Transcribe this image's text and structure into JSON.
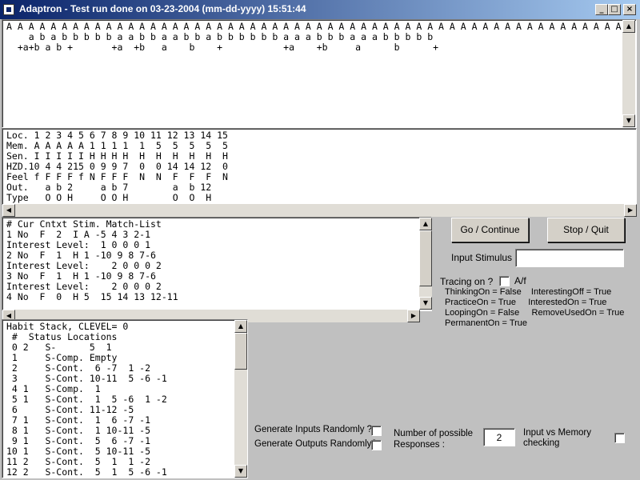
{
  "window": {
    "title": "Adaptron - Test run done on 03-23-2004 (mm-dd-yyyy) 15:51:44",
    "minimize": "_",
    "maximize": "□",
    "close": "×"
  },
  "sequence_panel": {
    "lines": [
      "A A A A A A A A A A A A A A A A A A A A A A A A A A A A A A A A A A A A A A A A A A A A A A A A A A A A A A A A A A A A A A",
      "    a b a b b b b b a a b b a a b b a b b b b b b a a a b b b a a a b b b b b",
      "  +a+b a b +       +a  +b   a    b    +           +a    +b     a      b      +"
    ]
  },
  "location_panel": {
    "lines": [
      "Loc. 1 2 3 4 5 6 7 8 9 10 11 12 13 14 15",
      "Mem. A A A A A 1 1 1 1  1  5  5  5  5  5",
      "Sen. I I I I I H H H H  H  H  H  H  H  H",
      "HZD.10 4 4 215 0 9 9 7  0  0 14 14 12  0",
      "Feel f F F F f N F F F  N  N  F  F  F  N",
      "Out.   a b 2     a b 7        a  b 12",
      "Type   O O H     O O H        O  O  H"
    ]
  },
  "match_panel": {
    "lines": [
      "# Cur Cntxt Stim. Match-List",
      "1 No  F  2  I A -5 4 3 2-1",
      "Interest Level:  1 0 0 0 1",
      "2 No  F  1  H 1 -10 9 8 7-6",
      "Interest Level:    2 0 0 0 2",
      "3 No  F  1  H 1 -10 9 8 7-6",
      "Interest Level:    2 0 0 0 2",
      "4 No  F  0  H 5  15 14 13 12-11"
    ]
  },
  "habit_panel": {
    "lines": [
      "Habit Stack, CLEVEL= 0",
      " #  Status Locations",
      " 0 2   S-      5  1",
      " 1     S-Comp. Empty",
      " 2     S-Cont.  6 -7  1 -2",
      " 3     S-Cont. 10-11  5 -6 -1",
      " 4 1   S-Comp.  1",
      " 5 1   S-Cont.  1  5 -6  1 -2",
      " 6     S-Cont. 11-12 -5",
      " 7 1   S-Cont.  1  6 -7 -1",
      " 8 1   S-Cont.  1 10-11 -5",
      " 9 1   S-Cont.  5  6 -7 -1",
      "10 1   S-Cont.  5 10-11 -5",
      "11 2   S-Cont.  5  1  1 -2",
      "12 2   S-Cont.  5  1  5 -6 -1"
    ]
  },
  "controls": {
    "go_label": "Go / Continue",
    "stop_label": "Stop / Quit",
    "input_stimulus_label": "Input Stimulus :",
    "input_stimulus_value": "",
    "tracing_label": "Tracing on ?",
    "af_label": "A/f",
    "status_lines": [
      "ThinkingOn = False    InterestingOff = True",
      "PracticeOn = True     InterestedOn = True",
      "LoopingOn = False     RemoveUsedOn = True",
      "PermanentOn = True"
    ],
    "gen_inputs_label": "Generate Inputs Randomly ?",
    "gen_outputs_label": "Generate Outputs Randomly?",
    "num_responses_label_1": "Number of possible",
    "num_responses_label_2": "Responses :",
    "num_responses_value": "2",
    "input_vs_memory_1": "Input vs Memory",
    "input_vs_memory_2": "checking"
  },
  "scroll": {
    "up": "▲",
    "down": "▼",
    "left": "◀",
    "right": "▶"
  }
}
